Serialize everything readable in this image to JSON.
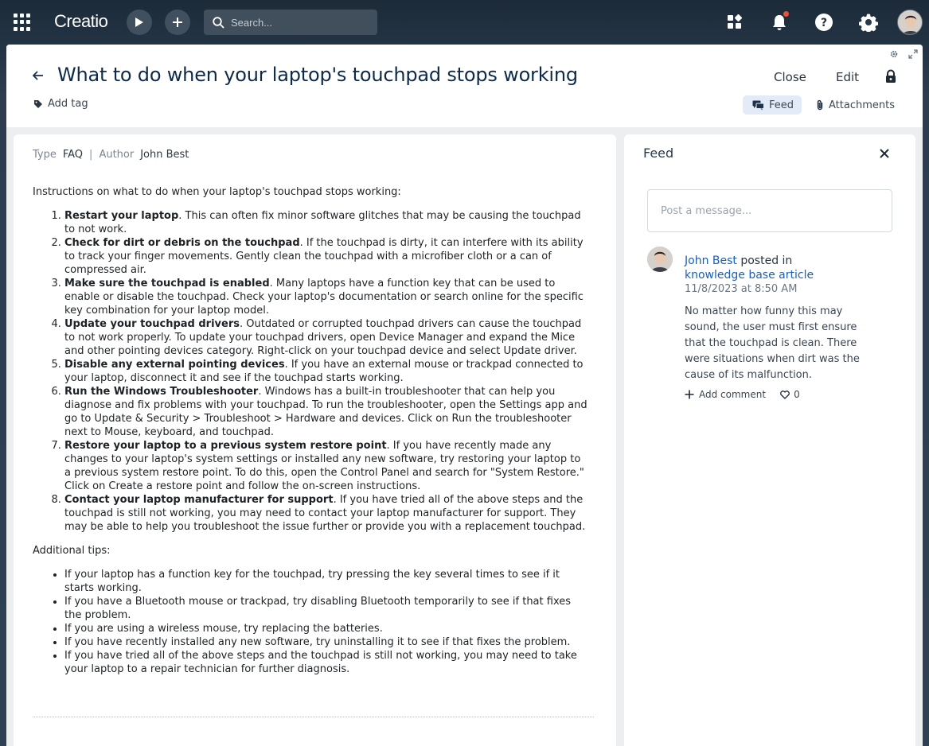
{
  "topbar": {
    "logo": "Creatio",
    "search_placeholder": "Search..."
  },
  "header": {
    "title": "What to do when your laptop's touchpad stops working",
    "close_label": "Close",
    "edit_label": "Edit",
    "add_tag_label": "Add tag",
    "tabs": [
      {
        "label": "Feed",
        "active": true
      },
      {
        "label": "Attachments",
        "active": false
      }
    ]
  },
  "article": {
    "type_label": "Type",
    "type_value": "FAQ",
    "author_label": "Author",
    "author_value": "John Best",
    "intro": "Instructions on what to do when your laptop's touchpad stops working:",
    "steps": [
      {
        "title": "Restart your laptop",
        "text": ". This can often fix minor software glitches that may be causing the touchpad to not work."
      },
      {
        "title": "Check for dirt or debris on the touchpad",
        "text": ". If the touchpad is dirty, it can interfere with its ability to track your finger movements. Gently clean the touchpad with a microfiber cloth or a can of compressed air."
      },
      {
        "title": "Make sure the touchpad is enabled",
        "text": ". Many laptops have a function key that can be used to enable or disable the touchpad. Check your laptop's documentation or search online for the specific key combination for your laptop model."
      },
      {
        "title": "Update your touchpad drivers",
        "text": ". Outdated or corrupted touchpad drivers can cause the touchpad to not work properly. To update your touchpad drivers, open Device Manager and expand the Mice and other pointing devices category. Right-click on your touchpad device and select Update driver."
      },
      {
        "title": "Disable any external pointing devices",
        "text": ". If you have an external mouse or trackpad connected to your laptop, disconnect it and see if the touchpad starts working."
      },
      {
        "title": "Run the Windows Troubleshooter",
        "text": ". Windows has a built-in troubleshooter that can help you diagnose and fix problems with your touchpad. To run the troubleshooter, open the Settings app and go to Update & Security > Troubleshoot > Hardware and devices. Click on Run the troubleshooter next to Mouse, keyboard, and touchpad."
      },
      {
        "title": "Restore your laptop to a previous system restore point",
        "text": ". If you have recently made any changes to your laptop's system settings or installed any new software, try restoring your laptop to a previous system restore point. To do this, open the Control Panel and search for \"System Restore.\" Click on Create a restore point and follow the on-screen instructions."
      },
      {
        "title": "Contact your laptop manufacturer for support",
        "text": ". If you have tried all of the above steps and the touchpad is still not working, you may need to contact your laptop manufacturer for support. They may be able to help you troubleshoot the issue further or provide you with a replacement touchpad."
      }
    ],
    "tips_heading": "Additional tips:",
    "tips": [
      "If your laptop has a function key for the touchpad, try pressing the key several times to see if it starts working.",
      "If you have a Bluetooth mouse or trackpad, try disabling Bluetooth temporarily to see if that fixes the problem.",
      "If you are using a wireless mouse, try replacing the batteries.",
      "If you have recently installed any new software, try uninstalling it to see if that fixes the problem.",
      "If you have tried all of the above steps and the touchpad is still not working, you may need to take your laptop to a repair technician for further diagnosis."
    ]
  },
  "feed": {
    "title": "Feed",
    "post_placeholder": "Post a message...",
    "post": {
      "author": "John Best",
      "action": "posted in",
      "link": "knowledge base article",
      "date": "11/8/2023 at 8:50 AM",
      "text": "No matter how funny this may sound, the user must first ensure that the touchpad is clean. There were situations when dirt was the cause of its malfunction.",
      "add_comment_label": "Add comment",
      "likes": "0"
    }
  },
  "colors": {
    "accent": "#1a5fb4",
    "title": "#0e2a48",
    "notification": "#e4533e"
  }
}
